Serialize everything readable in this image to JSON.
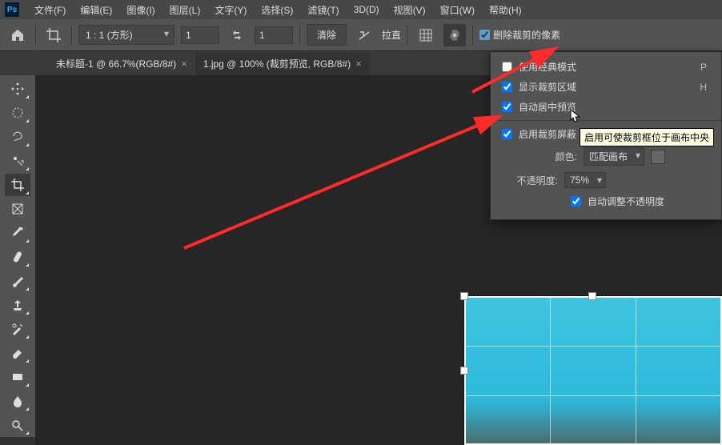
{
  "app": {
    "logo": "Ps"
  },
  "menus": [
    "文件(F)",
    "编辑(E)",
    "图像(I)",
    "图层(L)",
    "文字(Y)",
    "选择(S)",
    "滤镜(T)",
    "3D(D)",
    "视图(V)",
    "窗口(W)",
    "帮助(H)"
  ],
  "optbar": {
    "ratio": "1 : 1 (方形)",
    "w": "1",
    "h": "1",
    "clear": "清除",
    "straighten": "拉直",
    "delete_cropped": "删除裁剪的像素"
  },
  "tabs": [
    {
      "label": "未标题-1 @ 66.7%(RGB/8#)",
      "active": false
    },
    {
      "label": "1.jpg @ 100% (裁剪预览, RGB/8#)",
      "active": true
    }
  ],
  "panel": {
    "classic": "使用经典模式",
    "classic_key": "P",
    "show_area": "显示裁剪区域",
    "show_key": "H",
    "auto_center": "自动居中预览",
    "enable_shield": "启用裁剪屏蔽",
    "color_label": "颜色:",
    "color_value": "匹配画布",
    "opacity_label": "不透明度:",
    "opacity_value": "75%",
    "auto_opacity": "自动调整不透明度"
  },
  "tooltip": "启用可使裁剪框位于画布中央"
}
